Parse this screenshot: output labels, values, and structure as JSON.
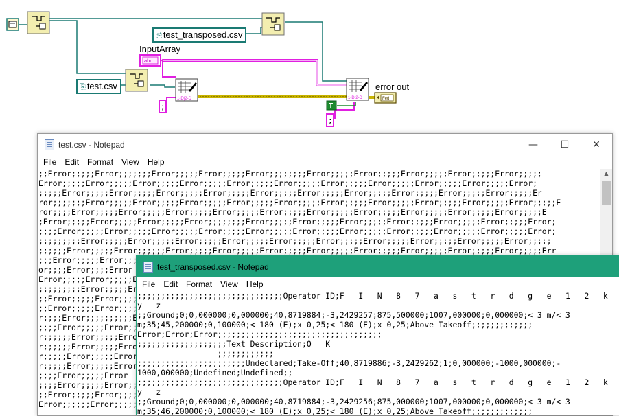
{
  "diagram": {
    "path_constant_1": "test_transposed.csv",
    "path_constant_2": "test.csv",
    "input_label": "InputArray",
    "error_label": "error out",
    "bool_const": "T",
    "colors": {
      "wire_path": "#1a7a73",
      "wire_string": "#e020e0",
      "wire_error": "#c8b400",
      "wire_bool": "#1e8a2e"
    }
  },
  "notepad1": {
    "title": "test.csv - Notepad",
    "menus": [
      "File",
      "Edit",
      "Format",
      "View",
      "Help"
    ],
    "controls": {
      "minimize": "—",
      "maximize": "☐",
      "close": "✕"
    },
    "lines": [
      ";;Error;;;;;Error;;;;;;;Error;;;;;Error;;;;;Error;;;;;;;;Error;;;;;Error;;;;;Error;;;;;Error;;;;;Error;;;;;",
      "Error;;;;;Error;;;;;Error;;;;;Error;;;;;Error;;;;;Error;;;;;Error;;;;;Error;;;;;Error;;;;;Error;;;;;Error;",
      ";;;;;Error;;;;;Error;;;;;Error;;;;;Error;;;;;Error;;;;;Error;;;;;Error;;;;;Error;;;;;Error;;;;;Error;;;;;Er",
      "ror;;;;;;;Error;;;;;Error;;;;;Error;;;;;Error;;;;;Error;;;;;Error;;;;;Error;;;;;Error;;;;;Error;;;;;Error;;;;;E",
      "ror;;;;Error;;;;;Error;;;;;Error;;;;;Error;;;;;Error;;;;;Error;;;;;Error;;;;;Error;;;;;Error;;;;;Error;;;;;E",
      ";Error;;;;;Error;;;;;Error;;;;;Error;;;;;;;;Error;;;;;Error;;;;;Error;;;;;Error;;;;;Error;;;;;Error;;;;;Error;",
      ";;;;Error;;;;;Error;;;;;Error;;;;;Error;;;;;Error;;;;;Error;;;;;Error;;;;;Error;;;;;Error;;;;;Error;;;;;Error;",
      ";;;;;;;;;Error;;;;;Error;;;;;Error;;;;;Error;;;;;Error;;;;;Error;;;;;Error;;;;;Error;;;;;Error;;;;;Error;;;;;",
      ";;;;;;Error;;;;;Error;;;;;;Error;;;;;Error;;;;;Error;;;;;Error;;;;;Error;;;;;Error;;;;;Error;;;;;Error;;;;;Err",
      ";;;Error;;;;;Error;;;;;Error",
      "or;;;;Error;;;;Error",
      "Error;;;;;Error;;;;;Error",
      ";;;;;;;;;Error;;;;;Error",
      ";;Error;;;;;Error;;;;;Error",
      ";;Error;;;;;Error;;;;;Error",
      "r;;;;Error;;;;;;;;;;Error",
      ";;;;Error;;;;;Error;;;;;Error",
      "r;;;;;;Error;;;;;Error",
      "r;;;;;;Error;;;;;Error",
      "r;;;;;Error;;;;;Error",
      "r;;;;;Error;;;;;Error",
      ";;;;Error;;;;;Error",
      ";;;;Error;;;;;Error;;;;;Error",
      ";;Error;;;;;Error;;;;;Error",
      "Error;;;;;;Error;;;;;Error"
    ]
  },
  "notepad2": {
    "title": "test_transposed.csv - Notepad",
    "menus": [
      "File",
      "Edit",
      "Format",
      "View",
      "Help"
    ],
    "lines": [
      ";;;;;;;;;;;;;;;;;;;;;;;;;;;;;;;Operator ID;F   I   N   8   7   a   s   t   r   d   g   e   1   2   k",
      "y   z",
      ";;Ground;0;0,000000;0,000000;40,8719884;-3,2429257;875,500000;1007,000000;0,000000;< 3 m/< 3",
      "m;35;45,200000;0,100000;< 180 (E);x 0,25;< 180 (E);x 0,25;Above Takeoff;;;;;;;;;;;;;",
      "Error;Error;Error;;;;;;;;;;;;;;;;;;;;;;;;;;;;;;;;;;;",
      ";;;;;;;;;;;;;;;;;;;Text Description;O   K",
      "                 ;;;;;;;;;;;;",
      ";;;;;;;;;;;;;;;;;;;;;;;Undeclared;Take-Off;40,8719886;-3,2429262;1;0,000000;-1000,000000;-",
      "1000,000000;Undefined;Undefined;;",
      ";;;;;;;;;;;;;;;;;;;;;;;;;;;;;;;Operator ID;F   I   N   8   7   a   s   t   r   d   g   e   1   2   k",
      "y   z",
      ";;Ground;0;0,000000;0,000000;40,8719884;-3,2429256;875,000000;1007,000000;0,000000;< 3 m/< 3",
      "m;35;46,200000;0,100000;< 180 (E);x 0,25;< 180 (E);x 0,25;Above Takeoff;;;;;;;;;;;;;"
    ]
  }
}
